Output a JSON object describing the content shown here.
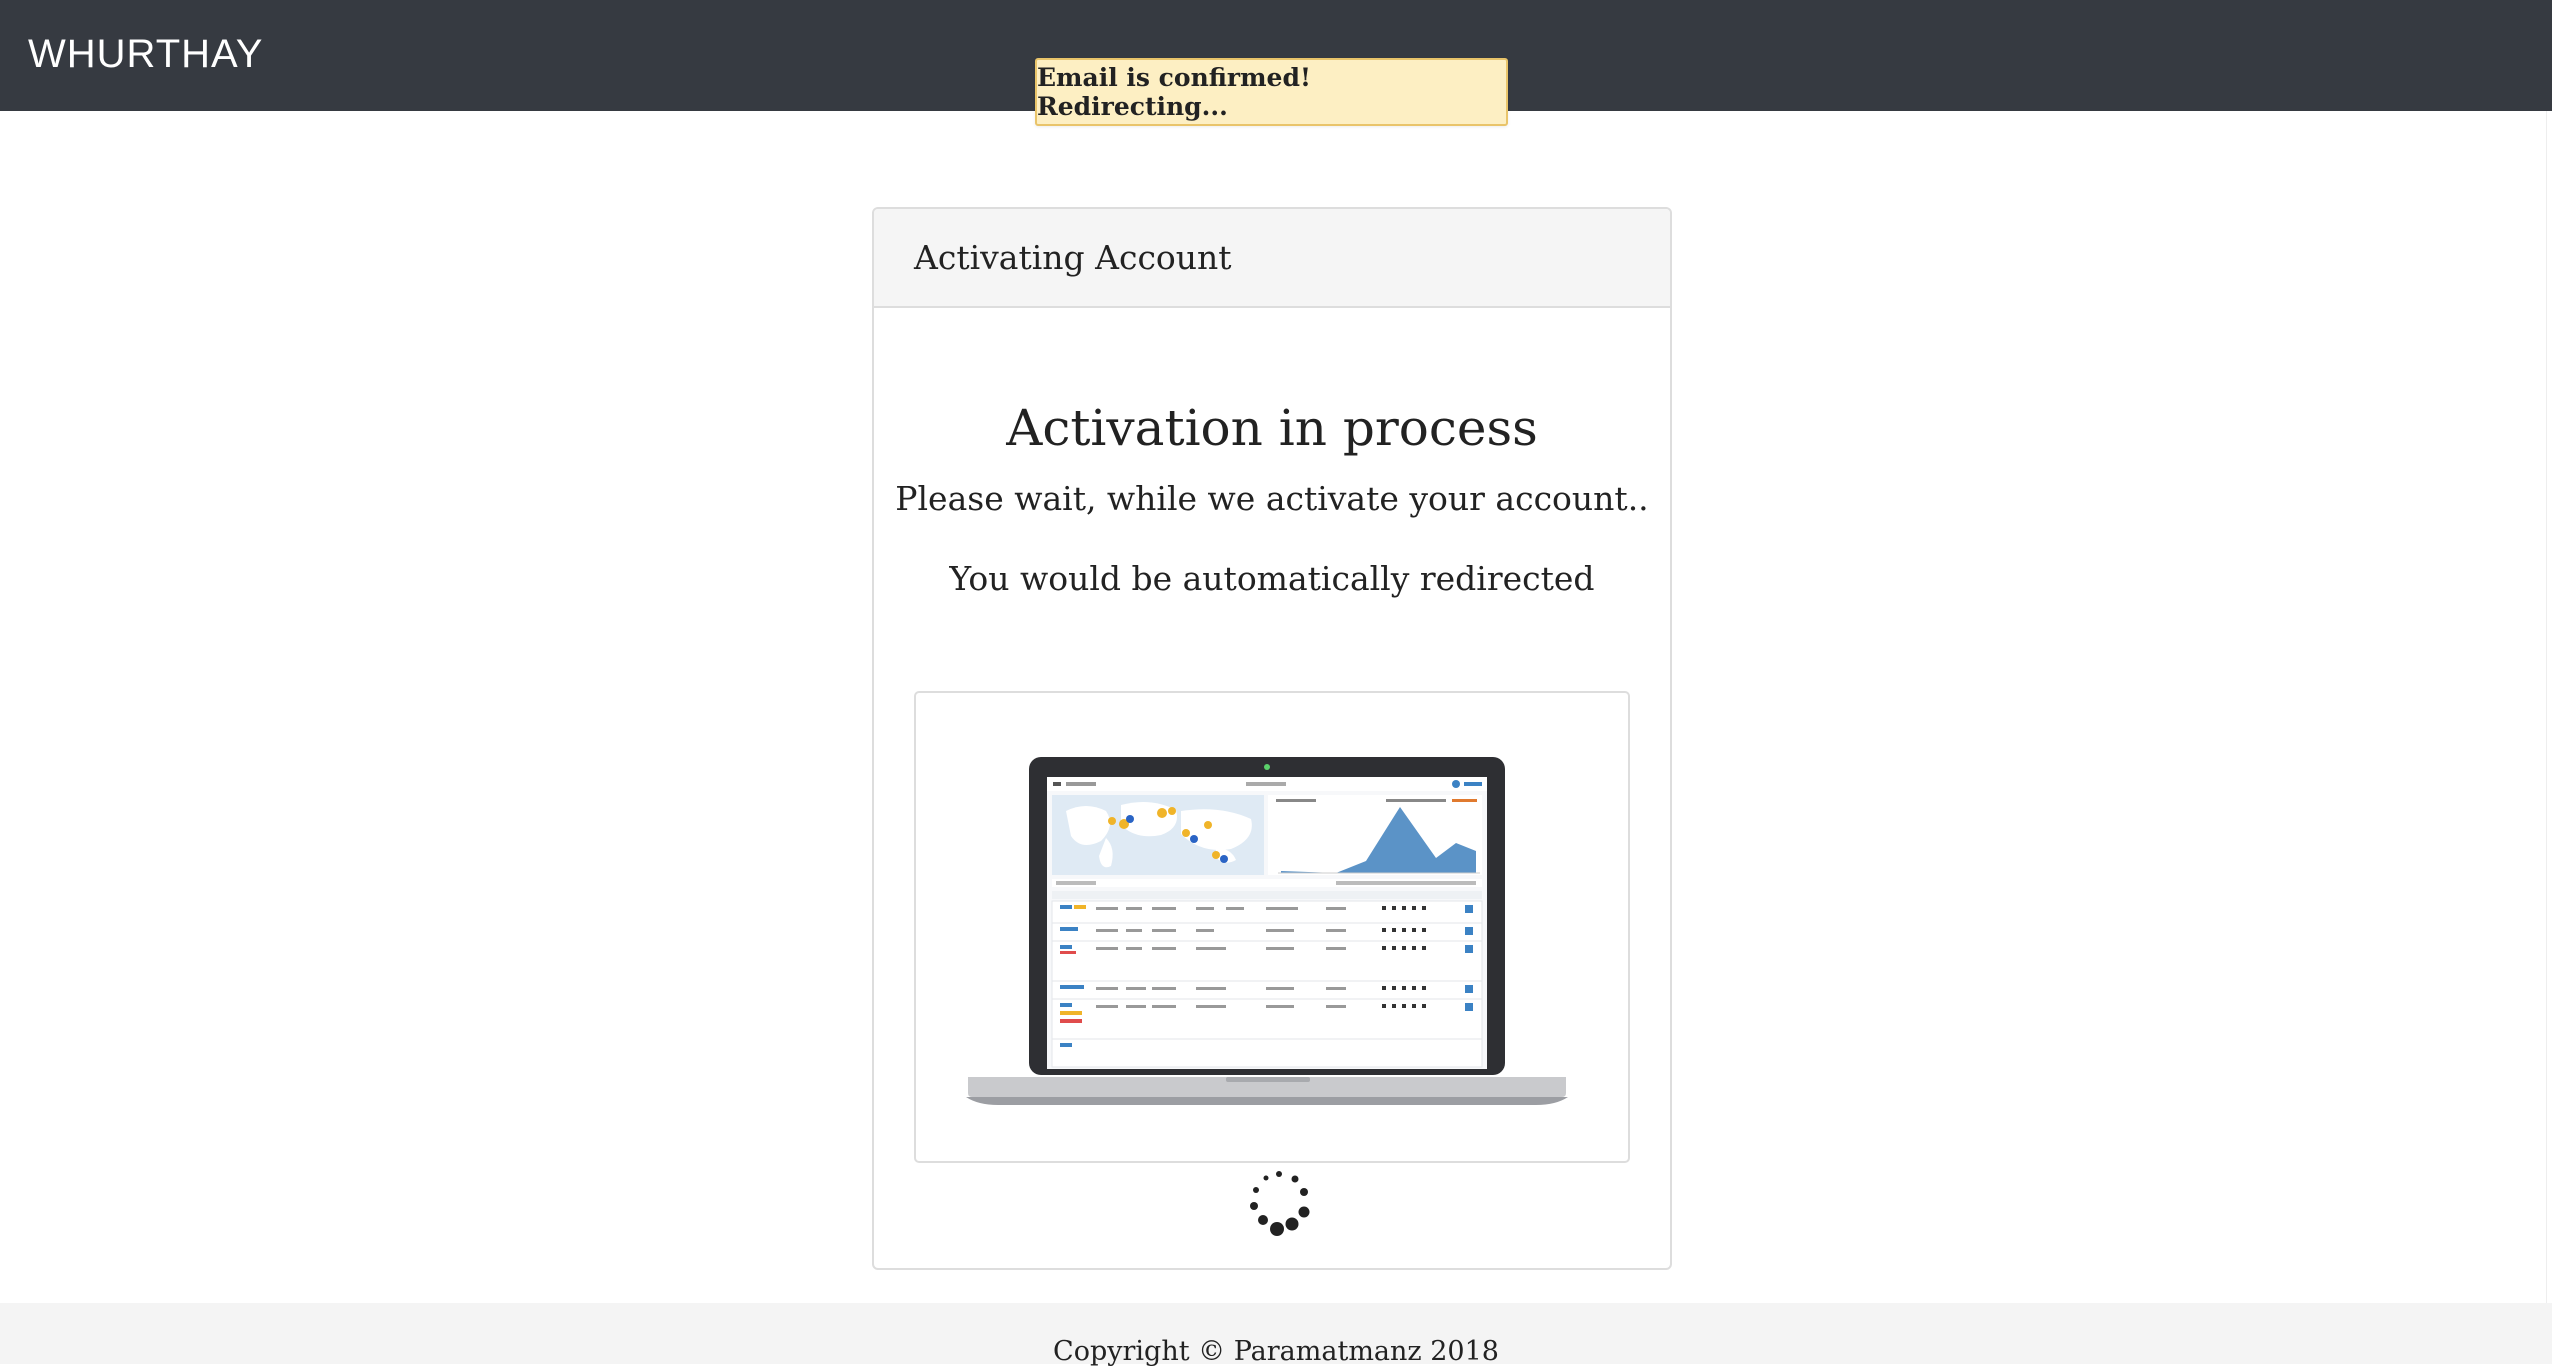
{
  "navbar": {
    "brand": "WHURTHAY"
  },
  "toast": {
    "message": "Email is confirmed! Redirecting..."
  },
  "card": {
    "header": "Activating Account",
    "heading": "Activation in process",
    "subtext": "Please wait, while we activate your account..",
    "redirect_text": "You would be automatically redirected",
    "image_icon": "laptop-dashboard-illustration",
    "spinner_icon": "loading-spinner-icon"
  },
  "footer": {
    "copyright": "Copyright © Paramatmanz 2018"
  },
  "colors": {
    "navbar_bg": "#363a41",
    "toast_bg": "#fdefc3",
    "toast_border": "#e9c46a",
    "card_header_bg": "#f5f5f5",
    "footer_bg": "#f4f4f4"
  }
}
